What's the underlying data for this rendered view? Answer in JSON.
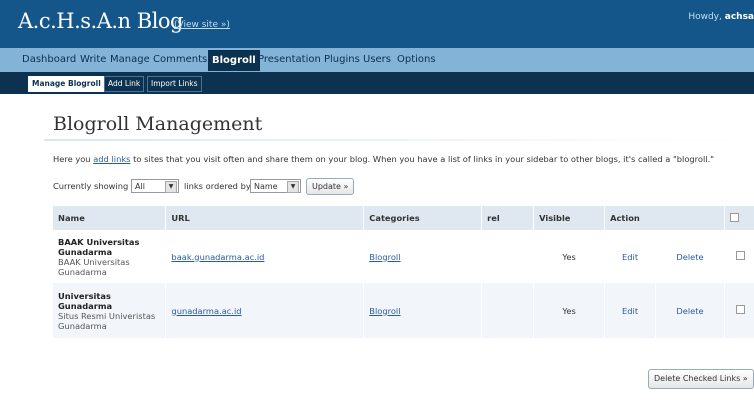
{
  "header": {
    "site_title": "A.c.H.s.A.n Blog",
    "view_site": "(View site »)",
    "howdy_prefix": "Howdy,",
    "username": "achsa"
  },
  "menu": [
    {
      "label": "Dashboard",
      "active": false
    },
    {
      "label": "Write",
      "active": false
    },
    {
      "label": "Manage",
      "active": false
    },
    {
      "label": "Comments",
      "active": false
    },
    {
      "label": "Blogroll",
      "active": true
    },
    {
      "label": "Presentation",
      "active": false
    },
    {
      "label": "Plugins",
      "active": false
    },
    {
      "label": "Users",
      "active": false
    },
    {
      "label": "Options",
      "active": false
    }
  ],
  "submenu": [
    {
      "label": "Manage Blogroll",
      "active": true
    },
    {
      "label": "Add Link",
      "active": false
    },
    {
      "label": "Import Links",
      "active": false
    }
  ],
  "page": {
    "title": "Blogroll Management",
    "intro_pre": "Here you ",
    "intro_link": "add links",
    "intro_post": " to sites that you visit often and share them on your blog. When you have a list of links in your sidebar to other blogs, it's called a \"blogroll.\""
  },
  "filter": {
    "showing_label": "Currently showing",
    "category_value": "All",
    "ordered_label": "links ordered by",
    "order_value": "Name",
    "update_button": "Update »"
  },
  "table": {
    "columns": [
      "Name",
      "URL",
      "Categories",
      "rel",
      "Visible",
      "Action"
    ],
    "rows": [
      {
        "name": "BAAK Universitas Gunadarma",
        "description": "BAAK Universitas Gunadarma",
        "url": "baak.gunadarma.ac.id",
        "category": "Blogroll",
        "rel": "",
        "visible": "Yes",
        "edit": "Edit",
        "delete": "Delete"
      },
      {
        "name": "Universitas Gunadarma",
        "description": "Situs Resmi Univeristas Gunadarma",
        "url": "gunadarma.ac.id",
        "category": "Blogroll",
        "rel": "",
        "visible": "Yes",
        "edit": "Edit",
        "delete": "Delete"
      }
    ]
  },
  "delete_checked_button": "Delete Checked Links »",
  "colors": {
    "header_bg": "#14568a",
    "menu_bg": "#83b4d8",
    "submenu_bg": "#0d324f",
    "table_header_bg": "#dfe8f1",
    "link": "#2a5b9e"
  }
}
